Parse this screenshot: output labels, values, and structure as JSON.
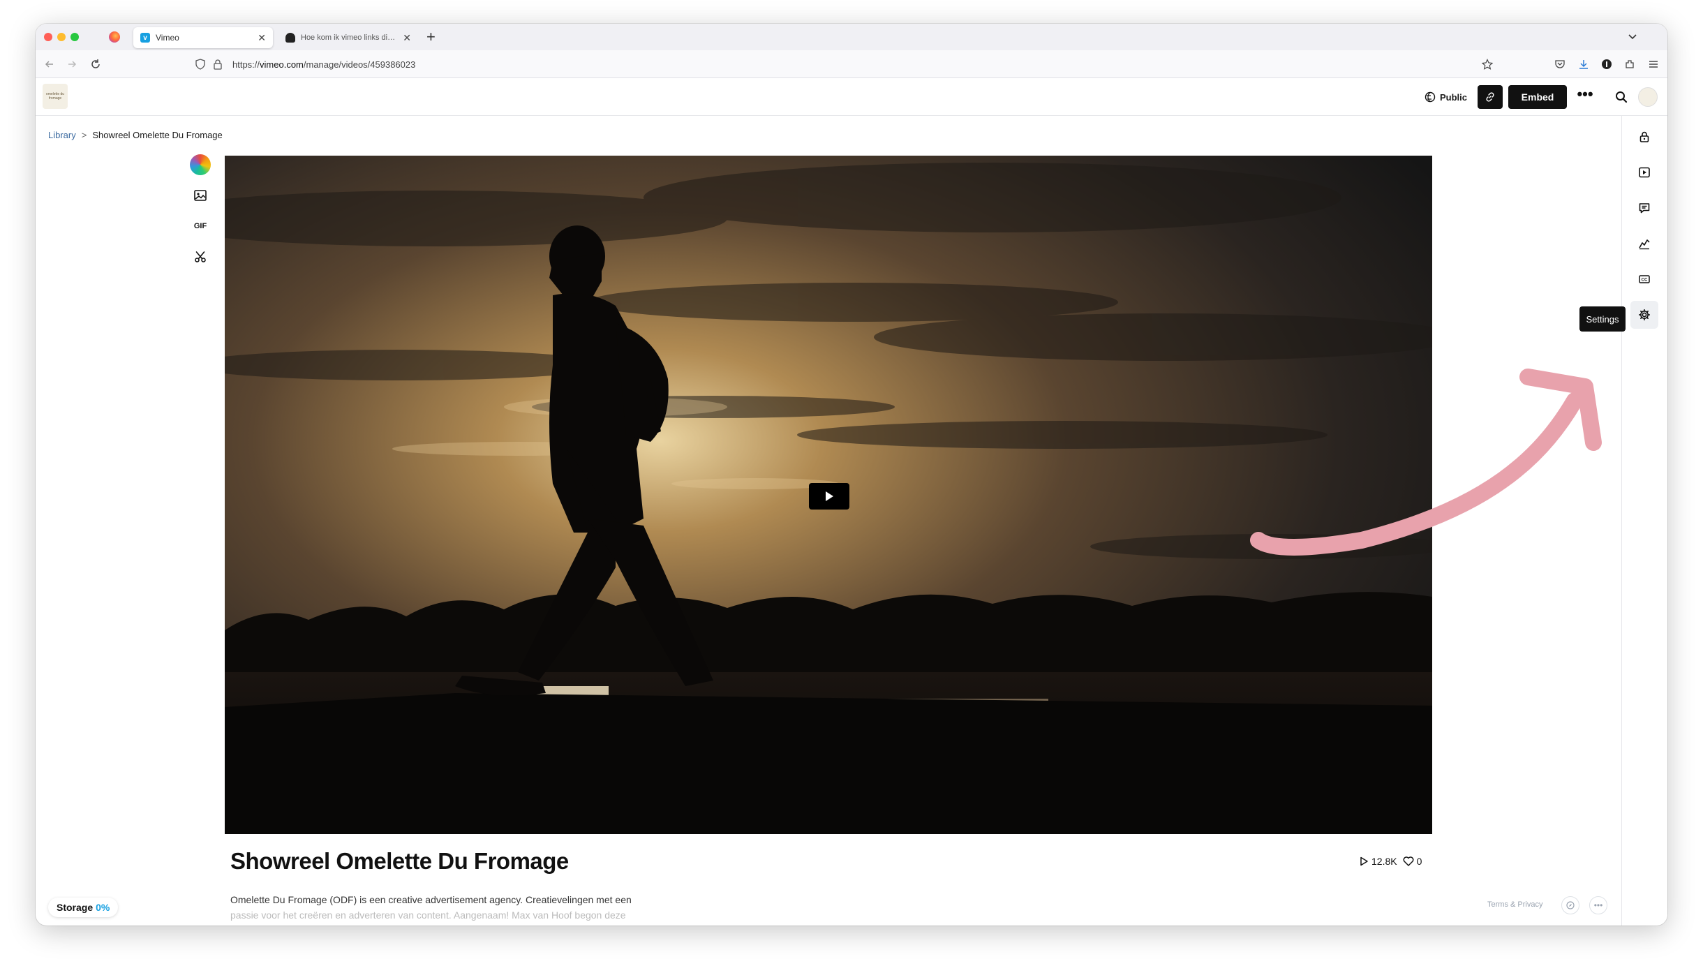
{
  "browser": {
    "tabs": [
      {
        "title": "Vimeo",
        "active": true,
        "favicon": "vimeo-icon"
      },
      {
        "title": "Hoe kom ik vimeo links die ik kan",
        "active": false,
        "favicon": "tab-favicon-icon"
      }
    ],
    "new_tab_label": "+",
    "close_glyph": "✕",
    "url_prefix": "https://",
    "url_host": "vimeo.com",
    "url_path": "/manage/videos/459386023"
  },
  "header": {
    "team_logo_text": "omelette du fromage",
    "privacy_label": "Public",
    "embed_label": "Embed",
    "more_label": "•••"
  },
  "breadcrumb": {
    "library": "Library",
    "separator": ">",
    "current": "Showreel Omelette Du Fromage"
  },
  "tools": {
    "gif_label": "GIF"
  },
  "right_rail": {
    "tooltip": "Settings",
    "items": [
      "lock-icon",
      "player-icon",
      "comments-icon",
      "analytics-icon",
      "captions-icon",
      "settings-icon"
    ]
  },
  "video": {
    "title": "Showreel Omelette Du Fromage",
    "plays": "12.8K",
    "likes": "0",
    "description_line1": "Omelette Du Fromage (ODF) is een creative advertisement agency. Creatievelingen met een",
    "description_line2": "passie voor het creëren en adverteren van content. Aangenaam! Max van Hoof begon deze"
  },
  "storage": {
    "label": "Storage",
    "percent": "0%"
  },
  "footer": {
    "terms": "Terms & Privacy",
    "more_label": "•••"
  },
  "colors": {
    "accent": "#17a0e1",
    "button_dark": "#111111",
    "annotation_arrow": "#e8a2ac"
  }
}
